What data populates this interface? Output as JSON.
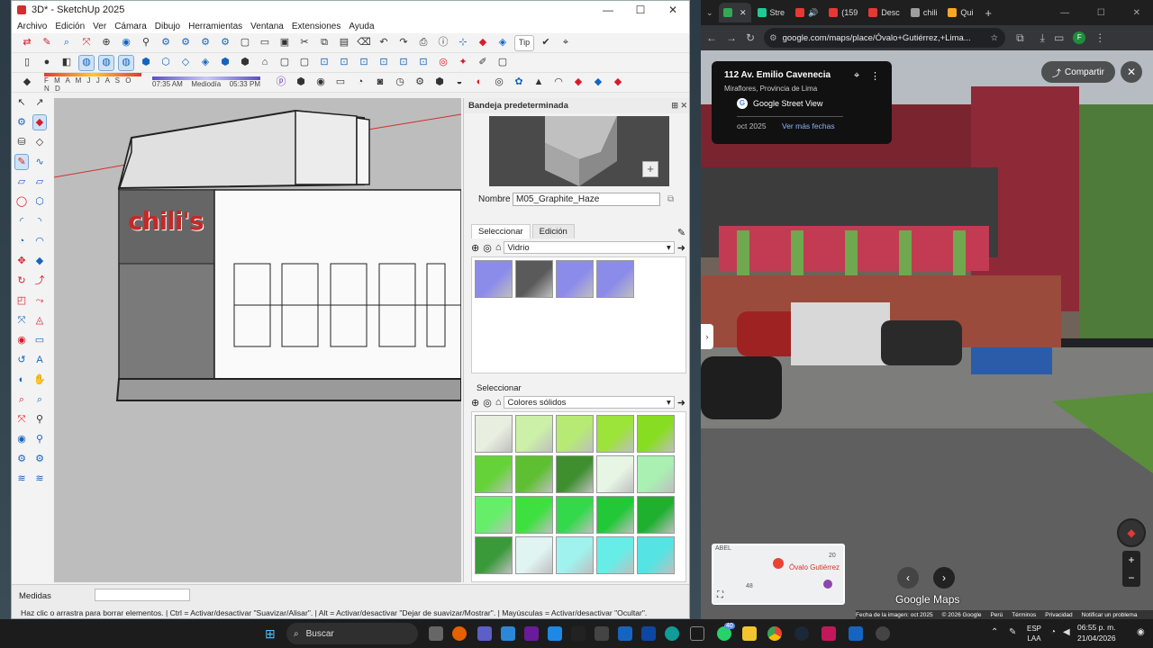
{
  "sketchup": {
    "title": "3D* - SketchUp 2025",
    "menu": [
      "Archivo",
      "Edición",
      "Ver",
      "Cámara",
      "Dibujo",
      "Herramientas",
      "Ventana",
      "Extensiones",
      "Ayuda"
    ],
    "tipo_label": "Tip",
    "shadow_scale": "F M A M J J A S O N D",
    "shadow_time_start": "07:35 AM",
    "shadow_time_mid": "Mediodía",
    "shadow_time_end": "05:33 PM",
    "tray": {
      "header": "Bandeja predeterminada",
      "name_label": "Nombre",
      "name_value": "M05_Graphite_Haze",
      "tab_select": "Seleccionar",
      "tab_edit": "Edición",
      "library_1": "Vidrio",
      "select_label_2": "Seleccionar",
      "library_2": "Colores sólidos"
    },
    "measurements_label": "Medidas",
    "status_text": "Haz clic o arrastra para borrar elementos. | Ctrl = Activar/desactivar \"Suavizar/Alisar\". | Alt = Activar/desactivar \"Dejar de suavizar/Mostrar\". | Mayúsculas = Activar/desactivar \"Ocultar\".",
    "sign_text": "chili's"
  },
  "chrome": {
    "tabs": [
      {
        "label": "Stre",
        "color": "#20c997"
      },
      {
        "label": "",
        "color": "#e53935"
      },
      {
        "label": "(159",
        "color": "#e53935"
      },
      {
        "label": "Desc",
        "color": "#e53935"
      },
      {
        "label": "chili",
        "color": "#9e9e9e"
      },
      {
        "label": "Qui",
        "color": "#f9a825"
      }
    ],
    "url": "google.com/maps/place/Óvalo+Gutiérrez,+Lima...",
    "profile_initial": "F",
    "address_title": "112 Av. Emilio Cavenecia",
    "address_sub": "Miraflores, Provincia de Lima",
    "sv_label": "Google Street View",
    "date": "oct 2025",
    "more_dates": "Ver más fechas",
    "share": "Compartir",
    "map_top_label": "ABEL",
    "map_place": "Óvalo Gutiérrez",
    "map_num_1": "20",
    "map_num_2": "48",
    "google_maps": "Google Maps",
    "footer": [
      "Fecha de la imagen: oct 2025",
      "© 2026 Google",
      "Perú",
      "Términos",
      "Privacidad",
      "Notificar un problema"
    ]
  },
  "taskbar": {
    "search": "Buscar",
    "lang_1": "ESP",
    "lang_2": "LAA",
    "time": "06:55 p. m.",
    "date": "21/04/2026",
    "badge": "40"
  },
  "swatches_glass": [
    "#8b8bea",
    "#5a5a5a",
    "#8b8bea",
    "#8b8bea"
  ],
  "swatches_solid": [
    "#e8eee0",
    "#ccf0a8",
    "#b6ea74",
    "#9ce33a",
    "#88dd22",
    "#66d23a",
    "#5fbf33",
    "#3f8f2f",
    "#e7f5e5",
    "#a9f0b2",
    "#66ee6a",
    "#3ee040",
    "#33d94a",
    "#22c838",
    "#20b030",
    "#3a9a3a",
    "#e0f5f2",
    "#9ff2ee",
    "#66ede8",
    "#55e3e3"
  ]
}
